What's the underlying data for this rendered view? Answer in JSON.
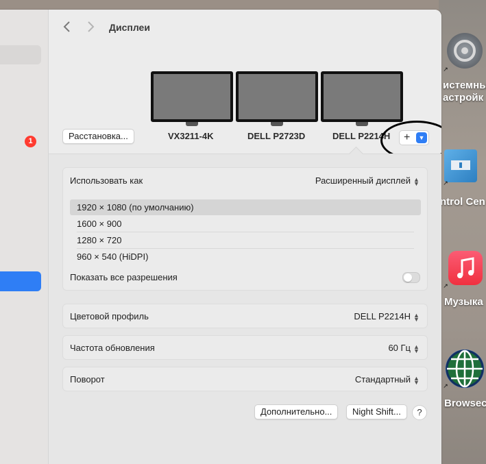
{
  "window": {
    "title": "Дисплеи",
    "back_icon": "chevron-left-icon",
    "forward_icon": "chevron-right-icon"
  },
  "sidebar": {
    "badge_count": "1"
  },
  "arrangement_button": "Расстановка...",
  "monitors": [
    {
      "name": "VX3211-4K"
    },
    {
      "name": "DELL P2723D"
    },
    {
      "name": "DELL P2214H",
      "selected": true
    }
  ],
  "add_display": {
    "plus": "+",
    "chevron": "⌄"
  },
  "use_as": {
    "label": "Использовать как",
    "value": "Расширенный дисплей"
  },
  "resolutions": {
    "items": [
      "1920 × 1080 (по умолчанию)",
      "1600 × 900",
      "1280 × 720",
      "960 × 540 (HiDPI)"
    ],
    "selected_index": 0,
    "show_all_label": "Показать все разрешения",
    "show_all_enabled": false
  },
  "color_profile": {
    "label": "Цветовой профиль",
    "value": "DELL P2214H"
  },
  "refresh_rate": {
    "label": "Частота обновления",
    "value": "60 Гц"
  },
  "rotation": {
    "label": "Поворот",
    "value": "Стандартный"
  },
  "footer": {
    "advanced_button": "Дополнительно...",
    "night_shift_button": "Night Shift...",
    "help": "?"
  },
  "desktop": {
    "icons": [
      {
        "label_line1": "истемны",
        "label_line2": "астройк"
      },
      {
        "label": "ntrol Cen"
      },
      {
        "label": "Музыка"
      },
      {
        "label": "Browsec"
      }
    ]
  },
  "colors": {
    "accent": "#2f7ef5",
    "badge": "#ff3b30"
  }
}
